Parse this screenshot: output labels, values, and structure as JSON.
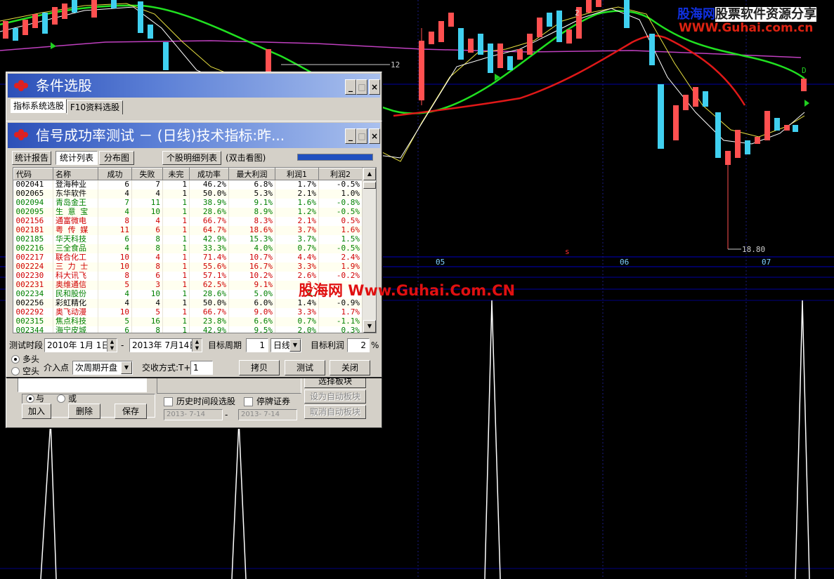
{
  "chart": {
    "price_labels": [
      "12",
      "18.80"
    ],
    "axis_labels": [
      "05",
      "06",
      "07"
    ],
    "marker_s": "s",
    "marker_2": "2",
    "marker_d": "D"
  },
  "logo": {
    "line1_blue": "股海网",
    "line1_rest": "股票软件资源分享",
    "line2": "WWW.Guhai.com.cn"
  },
  "watermark": "股海网 Www.Guhai.Com.CN",
  "back_window": {
    "title": "条件选股",
    "tabs": [
      "指标系统选股",
      "F10资料选股"
    ],
    "logic_and": "与",
    "logic_or": "或",
    "add": "加入",
    "delete": "删除",
    "save": "保存",
    "select_block": "选择板块",
    "history_period": "历史时间段选股",
    "suspended": "停牌证券",
    "set_auto_block": "设为自动板块",
    "cancel_auto_block": "取消自动板块",
    "date_from": "2013- 7-14",
    "date_to": "2013- 7-14"
  },
  "front_window": {
    "title": "信号成功率测试 － (日线)技术指标:昨...",
    "tabs": [
      "统计报告",
      "统计列表",
      "分布图"
    ],
    "detail_button": "个股明细列表",
    "hint": "(双击看图)",
    "columns": [
      "代码",
      "名称",
      "成功",
      "失败",
      "未完",
      "成功率",
      "最大利润",
      "利润1",
      "利润2"
    ],
    "rows": [
      {
        "code": "002041",
        "name": "登海种业",
        "s": "6",
        "f": "7",
        "u": "1",
        "rate": "46.2%",
        "max": "6.8%",
        "p1": "1.7%",
        "p2": "-0.5%",
        "color": "black"
      },
      {
        "code": "002065",
        "name": "东华软件",
        "s": "4",
        "f": "4",
        "u": "1",
        "rate": "50.0%",
        "max": "5.3%",
        "p1": "2.1%",
        "p2": "1.0%",
        "color": "black"
      },
      {
        "code": "002094",
        "name": "青岛金王",
        "s": "7",
        "f": "11",
        "u": "1",
        "rate": "38.9%",
        "max": "9.1%",
        "p1": "1.6%",
        "p2": "-0.8%",
        "color": "green"
      },
      {
        "code": "002095",
        "name": "生 意 宝",
        "s": "4",
        "f": "10",
        "u": "1",
        "rate": "28.6%",
        "max": "8.9%",
        "p1": "1.2%",
        "p2": "-0.5%",
        "color": "green"
      },
      {
        "code": "002156",
        "name": "通富微电",
        "s": "8",
        "f": "4",
        "u": "1",
        "rate": "66.7%",
        "max": "8.3%",
        "p1": "2.1%",
        "p2": "0.5%",
        "color": "red"
      },
      {
        "code": "002181",
        "name": "粤 传 媒",
        "s": "11",
        "f": "6",
        "u": "1",
        "rate": "64.7%",
        "max": "18.6%",
        "p1": "3.7%",
        "p2": "1.6%",
        "color": "red"
      },
      {
        "code": "002185",
        "name": "华天科技",
        "s": "6",
        "f": "8",
        "u": "1",
        "rate": "42.9%",
        "max": "15.3%",
        "p1": "3.7%",
        "p2": "1.5%",
        "color": "green"
      },
      {
        "code": "002216",
        "name": "三全食品",
        "s": "4",
        "f": "8",
        "u": "1",
        "rate": "33.3%",
        "max": "4.0%",
        "p1": "0.7%",
        "p2": "-0.5%",
        "color": "green"
      },
      {
        "code": "002217",
        "name": "联合化工",
        "s": "10",
        "f": "4",
        "u": "1",
        "rate": "71.4%",
        "max": "10.7%",
        "p1": "4.4%",
        "p2": "2.4%",
        "color": "red"
      },
      {
        "code": "002224",
        "name": "三 力 士",
        "s": "10",
        "f": "8",
        "u": "1",
        "rate": "55.6%",
        "max": "16.7%",
        "p1": "3.3%",
        "p2": "1.9%",
        "color": "red"
      },
      {
        "code": "002230",
        "name": "科大讯飞",
        "s": "8",
        "f": "6",
        "u": "1",
        "rate": "57.1%",
        "max": "10.2%",
        "p1": "2.6%",
        "p2": "-0.2%",
        "color": "red"
      },
      {
        "code": "002231",
        "name": "奥维通信",
        "s": "5",
        "f": "3",
        "u": "1",
        "rate": "62.5%",
        "max": "9.1%",
        "p1": "3.",
        "p2": "",
        "color": "red"
      },
      {
        "code": "002234",
        "name": "民和股份",
        "s": "4",
        "f": "10",
        "u": "1",
        "rate": "28.6%",
        "max": "5.0%",
        "p1": "0.",
        "p2": "",
        "color": "green"
      },
      {
        "code": "002256",
        "name": "彩虹精化",
        "s": "4",
        "f": "4",
        "u": "1",
        "rate": "50.0%",
        "max": "6.0%",
        "p1": "1.4%",
        "p2": "-0.9%",
        "color": "black"
      },
      {
        "code": "002292",
        "name": "奥飞动漫",
        "s": "10",
        "f": "5",
        "u": "1",
        "rate": "66.7%",
        "max": "9.0%",
        "p1": "3.3%",
        "p2": "1.7%",
        "color": "red"
      },
      {
        "code": "002315",
        "name": "焦点科技",
        "s": "5",
        "f": "16",
        "u": "1",
        "rate": "23.8%",
        "max": "6.6%",
        "p1": "0.7%",
        "p2": "-1.1%",
        "color": "green"
      },
      {
        "code": "002344",
        "name": "海宁皮城",
        "s": "6",
        "f": "8",
        "u": "1",
        "rate": "42.9%",
        "max": "9.5%",
        "p1": "2.0%",
        "p2": "0.3%",
        "color": "green"
      }
    ],
    "test_period_label": "测试时段",
    "date_from": "2010年 1月 1日",
    "date_sep": "-",
    "date_to": "2013年 7月14日",
    "target_period_label": "目标周期",
    "target_period_value": "1",
    "period_unit": "日线",
    "target_profit_label": "目标利润",
    "target_profit_value": "2",
    "percent": "%",
    "long": "多头",
    "short": "空头",
    "entry_label": "介入点",
    "entry_value": "次周期开盘",
    "settle_label": "交收方式:T+",
    "settle_value": "1",
    "copy": "拷贝",
    "test": "测试",
    "close": "关闭"
  }
}
